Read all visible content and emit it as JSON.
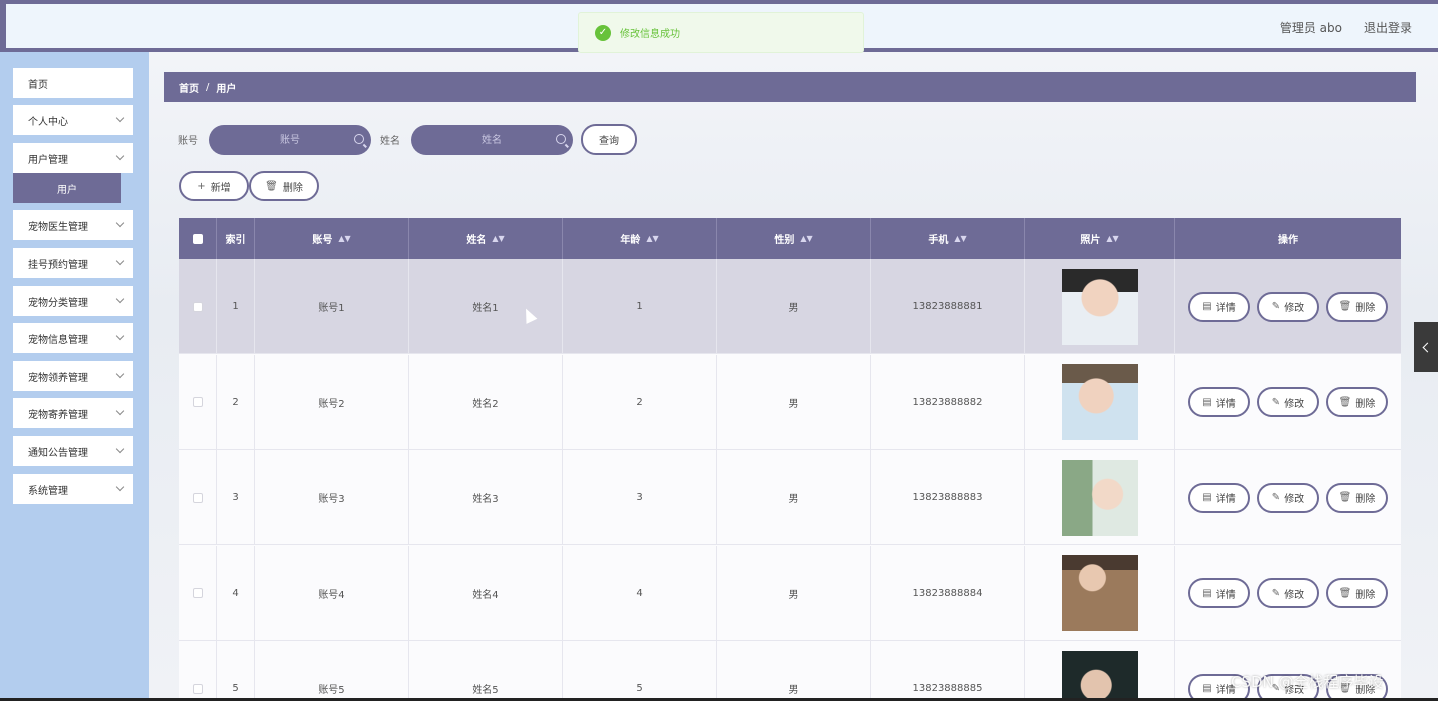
{
  "header": {
    "user_label": "管理员 abo",
    "logout_label": "退出登录"
  },
  "toast": {
    "message": "修改信息成功"
  },
  "sidebar": {
    "items": [
      {
        "label": "首页",
        "has_chevron": false
      },
      {
        "label": "个人中心",
        "has_chevron": true
      },
      {
        "label": "用户管理",
        "has_chevron": true
      },
      {
        "label": "宠物医生管理",
        "has_chevron": true
      },
      {
        "label": "挂号预约管理",
        "has_chevron": true
      },
      {
        "label": "宠物分类管理",
        "has_chevron": true
      },
      {
        "label": "宠物信息管理",
        "has_chevron": true
      },
      {
        "label": "宠物领养管理",
        "has_chevron": true
      },
      {
        "label": "宠物寄养管理",
        "has_chevron": true
      },
      {
        "label": "通知公告管理",
        "has_chevron": true
      },
      {
        "label": "系统管理",
        "has_chevron": true
      }
    ],
    "active_sub": "用户"
  },
  "breadcrumb": {
    "home": "首页",
    "sep": "/",
    "current": "用户"
  },
  "search": {
    "account_label": "账号",
    "account_placeholder": "账号",
    "name_label": "姓名",
    "name_placeholder": "姓名",
    "query_button": "查询"
  },
  "toolbar": {
    "add_label": "新增",
    "delete_label": "删除"
  },
  "table": {
    "headers": [
      "索引",
      "账号",
      "姓名",
      "年龄",
      "性别",
      "手机",
      "照片",
      "操作"
    ],
    "rows": [
      {
        "index": "1",
        "account": "账号1",
        "name": "姓名1",
        "age": "1",
        "gender": "男",
        "phone": "13823888881"
      },
      {
        "index": "2",
        "account": "账号2",
        "name": "姓名2",
        "age": "2",
        "gender": "男",
        "phone": "13823888882"
      },
      {
        "index": "3",
        "account": "账号3",
        "name": "姓名3",
        "age": "3",
        "gender": "男",
        "phone": "13823888883"
      },
      {
        "index": "4",
        "account": "账号4",
        "name": "姓名4",
        "age": "4",
        "gender": "男",
        "phone": "13823888884"
      },
      {
        "index": "5",
        "account": "账号5",
        "name": "姓名5",
        "age": "5",
        "gender": "男",
        "phone": "13823888885"
      }
    ],
    "actions": {
      "detail": "详情",
      "edit": "修改",
      "delete": "删除"
    }
  },
  "watermark": "CSDN @全栈程序毕设",
  "colors": {
    "primary": "#6e6b96",
    "sidebar_bg": "#b3cdee",
    "toast_green": "#67c23a"
  }
}
